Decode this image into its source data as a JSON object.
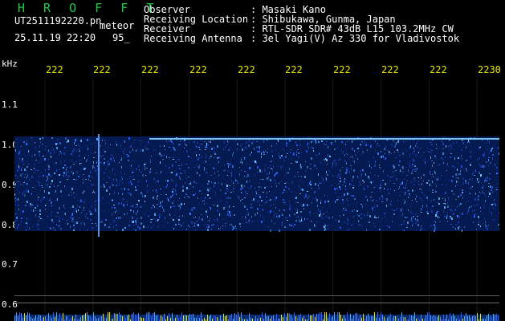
{
  "header": {
    "app_name": "H R O F F T",
    "filename": "UT2511192220.pn",
    "mode": "meteor",
    "datetime": "25.11.19 22:20",
    "count": "95_",
    "info_labels": [
      "Observer",
      "Receiving Location",
      "Receiver",
      "Receiving Antenna"
    ],
    "info_values": [
      ": Masaki Kano",
      ": Shibukawa, Gunma, Japan",
      ": RTL-SDR SDR# 43dB L15 103.2MHz CW",
      ": 3el Yagi(V) Az 330 for Vladivostok"
    ]
  },
  "x_axis": {
    "ticks": [
      "222",
      "222",
      "222",
      "222",
      "222",
      "222",
      "222",
      "222",
      "222",
      "2230"
    ]
  },
  "y_axis": {
    "unit": "kHz",
    "ticks": [
      "1.1",
      "1.0",
      "0.9",
      "0.8",
      "0.7",
      "0.6"
    ]
  },
  "colors": {
    "background": "#000000",
    "signal": "#2a5cff",
    "header_green": "#22c84a",
    "tick_yellow": "#e6e600"
  }
}
